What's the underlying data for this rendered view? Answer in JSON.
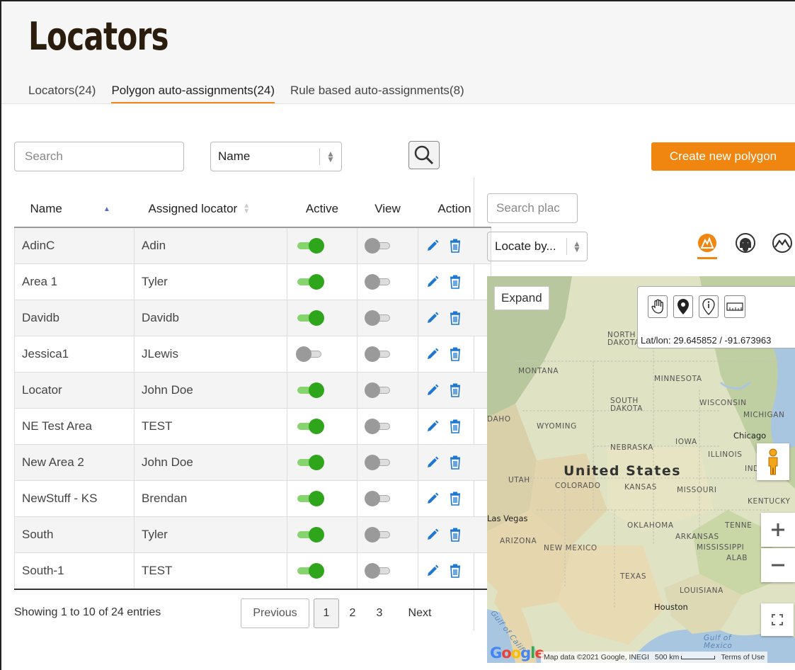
{
  "page": {
    "title": "Locators"
  },
  "tabs": [
    {
      "label": "Locators(24)"
    },
    {
      "label": "Polygon auto-assignments(24)"
    },
    {
      "label": "Rule based auto-assignments(8)"
    }
  ],
  "filters": {
    "search_placeholder": "Search",
    "field_select_value": "Name"
  },
  "create_button_label": "Create new polygon",
  "table": {
    "columns": [
      "Name",
      "Assigned locator",
      "Active",
      "View",
      "Action"
    ],
    "rows": [
      {
        "name": "AdinC",
        "locator": "Adin",
        "active": true,
        "view": false
      },
      {
        "name": "Area 1",
        "locator": "Tyler",
        "active": true,
        "view": false
      },
      {
        "name": "Davidb",
        "locator": "Davidb",
        "active": true,
        "view": false
      },
      {
        "name": "Jessica1",
        "locator": "JLewis",
        "active": false,
        "view": false
      },
      {
        "name": "Locator",
        "locator": "John Doe",
        "active": true,
        "view": false
      },
      {
        "name": "NE Test Area",
        "locator": "TEST",
        "active": true,
        "view": false
      },
      {
        "name": "New Area 2",
        "locator": "John Doe",
        "active": true,
        "view": false
      },
      {
        "name": "NewStuff - KS",
        "locator": "Brendan",
        "active": true,
        "view": false
      },
      {
        "name": "South",
        "locator": "Tyler",
        "active": true,
        "view": false
      },
      {
        "name": "South-1",
        "locator": "TEST",
        "active": true,
        "view": false
      }
    ]
  },
  "pagination": {
    "summary": "Showing 1 to 10 of 24 entries",
    "previous": "Previous",
    "pages": [
      "1",
      "2",
      "3"
    ],
    "next": "Next"
  },
  "map_panel": {
    "search_placeholder": "Search plac",
    "locate_by": "Locate by...",
    "expand": "Expand",
    "latlon": "Lat/lon: 29.645852 / -91.673963",
    "attribution": "Map data ©2021 Google, INEGI",
    "scale": "500 km",
    "terms": "Terms of Use",
    "labels": {
      "montana": "MONTANA",
      "north_dakota": "NORTH\nDAKOTA",
      "minnesota": "MINNESOTA",
      "south_dakota": "SOUTH\nDAKOTA",
      "wisconsin": "WISCONSIN",
      "michigan": "MICHIGAN",
      "idaho": "DAHO",
      "wyoming": "WYOMING",
      "iowa": "IOWA",
      "chicago": "Chicago",
      "nebraska": "NEBRASKA",
      "illinois": "ILLINOIS",
      "indiana": "IND",
      "united_states": "United States",
      "utah": "UTAH",
      "colorado": "COLORADO",
      "kansas": "KANSAS",
      "missouri": "MISSOURI",
      "kentucky": "KENTUCKY",
      "las_vegas": "Las Vegas",
      "oklahoma": "OKLAHOMA",
      "tennessee": "TENNE",
      "arkansas": "ARKANSAS",
      "arizona": "ARIZONA",
      "new_mexico": "NEW MEXICO",
      "mississippi": "MISSISSIPPI",
      "alabama": "ALAB",
      "texas": "TEXAS",
      "louisiana": "LOUISIANA",
      "houston": "Houston",
      "gulf_of_california": "Gulf of Calif",
      "gulf_of_mexico": "Gulf of\nMexico"
    }
  },
  "colors": {
    "accent": "#f0860f",
    "toggle_on": "#2fa51c",
    "sort_active": "#5b6cc7",
    "action_blue": "#1e78d0"
  }
}
